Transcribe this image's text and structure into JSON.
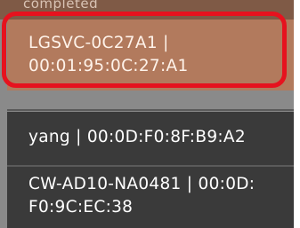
{
  "header": {
    "status_label": "completed"
  },
  "devices": [
    {
      "line1": "LGSVC-0C27A1 |",
      "line2": "00:01:95:0C:27:A1",
      "selected": true
    },
    {
      "line1": "yang | 00:0D:F0:8F:B9:A2",
      "selected": false
    },
    {
      "line1": "CW-AD10-NA0481 | 00:0D:",
      "line2": "F0:9C:EC:38",
      "selected": false
    }
  ],
  "colors": {
    "selected_row": "#b27a5d",
    "normal_row": "#3a3a3a",
    "annotation": "#e6121e"
  }
}
